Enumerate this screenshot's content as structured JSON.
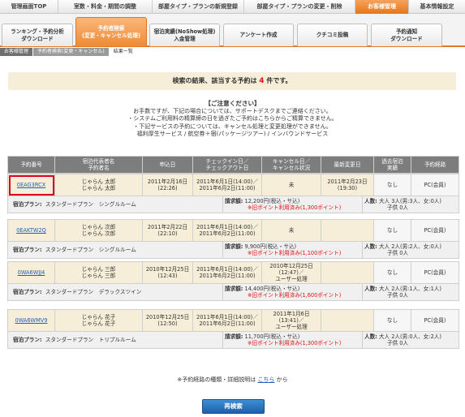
{
  "topnav": [
    "管理画面TOP",
    "室数・料金・期間の調整",
    "部屋タイプ・プランの新規登録",
    "部屋タイプ・プランの変更・削除",
    "お客様管理",
    "基本情報設定"
  ],
  "subnav": [
    {
      "l1": "ランキング・予約分析",
      "l2": "ダウンロード"
    },
    {
      "l1": "予約者検索",
      "l2": "(変更・キャンセル処理)"
    },
    {
      "l1": "宿泊実績(NoShow処理)",
      "l2": "入金管理"
    },
    {
      "l1": "アンケート作成",
      "l2": ""
    },
    {
      "l1": "クチコミ投稿",
      "l2": ""
    },
    {
      "l1": "予約通知",
      "l2": "ダウンロード"
    }
  ],
  "breadcrumb": [
    "お客様管理",
    "予約者検索(変更・キャンセル)",
    "結果一覧"
  ],
  "result": {
    "prefix": "検索の結果、該当する予約は",
    "count": "4",
    "suffix": "件です。"
  },
  "notice": {
    "title": "【ご注意ください】",
    "lines": [
      "お手数ですが、下記の場合については、サポートデスクまでご連絡ください。",
      "・システムご利用料の精算締の日を過ぎたご予約はこちらからご精算できません。",
      "・下記サービスの予約については、キャンセル処理と変更処理ができません。",
      "福利厚生サービス / 航空券＋宿(パッケージツアー) / インバウンドサービス"
    ]
  },
  "headers": [
    "予約番号",
    "宿泊代表者名\n予約者名",
    "申込日",
    "チェックイン日／\nチェックアウト日",
    "キャンセル日／\nキャンセル状況",
    "最新変更日",
    "過去宿泊\n実績",
    "予約経路"
  ],
  "records": [
    {
      "id": "0EAG3RCX",
      "name1": "じゃらん 太郎",
      "name2": "じゃらん 太郎",
      "applied": "2011年2月16日\n(22:26)",
      "stay": "2011年6月1日(14:00)／\n2011年6月2日(11:00)",
      "cancel": "未",
      "changed": "2011年2月23日\n(19:30)",
      "past": "なし",
      "route": "PC(会員)",
      "plan": "スタンダードプラン　シングルルーム",
      "amount": "12,200円(税込・サ込)",
      "point": "※旧ポイント利用済み(1,300ポイント)",
      "people1": "大人 3人(男:3人、女:0人)",
      "people2": "子供 0人"
    },
    {
      "id": "0EAKTW2Q",
      "name1": "じゃらん 次郎",
      "name2": "じゃらん 次郎",
      "applied": "2011年2月22日\n(22:10)",
      "stay": "2011年6月1日(14:00)／\n2011年6月2日(11:00)",
      "cancel": "未",
      "changed": "",
      "past": "なし",
      "route": "PC(会員)",
      "plan": "スタンダードプラン　シングルルーム",
      "amount": "9,900円(税込・サ込)",
      "point": "※旧ポイント利用済み(1,100ポイント)",
      "people1": "大人 2人(男:2人、女:0人)",
      "people2": "子供 0人"
    },
    {
      "id": "0WA6WJJ4",
      "name1": "じゃらん 三郎",
      "name2": "じゃらん 三郎",
      "applied": "2010年12月25日\n(12:43)",
      "stay": "2011年6月1日(14:00)／\n2011年6月2日(11:00)",
      "cancel": "2010年12月25日\n(12:47)／\nユーザー処理",
      "changed": "",
      "past": "なし",
      "route": "PC(会員)",
      "plan": "スタンダードプラン　デラックスツイン",
      "amount": "14,400円(税込・サ込)",
      "point": "※旧ポイント利用済み(1,600ポイント)",
      "people1": "大人 2人(男:1人、女:1人)",
      "people2": "子供 0人"
    },
    {
      "id": "0WA6WMV9",
      "name1": "じゃらん 花子",
      "name2": "じゃらん 花子",
      "applied": "2010年12月25日\n(12:50)",
      "stay": "2011年6月1日(14:00)／\n2011年6月2日(11:00)",
      "cancel": "2011年1月6日\n(13:41)／\nユーザー処理",
      "changed": "",
      "past": "なし",
      "route": "PC(会員)",
      "plan": "スタンダードプラン　トリプルルーム",
      "amount": "11,700円(税込・サ込)",
      "point": "※旧ポイント利用済み(1,300ポイント)",
      "people1": "大人 2人(男:0人、女:2人)",
      "people2": "子供 0人"
    }
  ],
  "labels": {
    "plan": "宿泊プラン:",
    "amount": "請求額:",
    "people": "人数:"
  },
  "footer": {
    "prefix": "※予約経路の種類・詳細説明は",
    "link": "こちら",
    "suffix": "から"
  },
  "research_button": "再検索",
  "colors": {
    "accent": "#e4761c",
    "highlight": "#d6001c",
    "link": "#1f5dc2"
  }
}
